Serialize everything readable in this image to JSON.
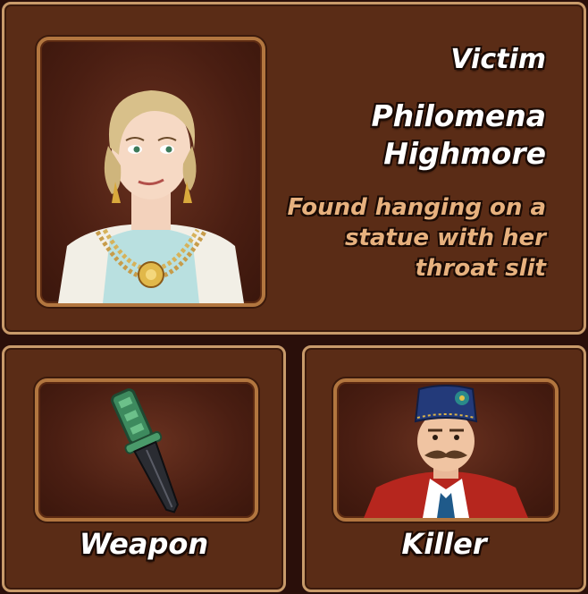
{
  "victim": {
    "label": "Victim",
    "name": "Philomena Highmore",
    "description": "Found hanging on a statue with her throat slit"
  },
  "weapon": {
    "caption": "Weapon"
  },
  "killer": {
    "caption": "Killer"
  },
  "colors": {
    "panel": "#5a2c16",
    "border": "#c89a6a",
    "description_text": "#e7b17e"
  }
}
